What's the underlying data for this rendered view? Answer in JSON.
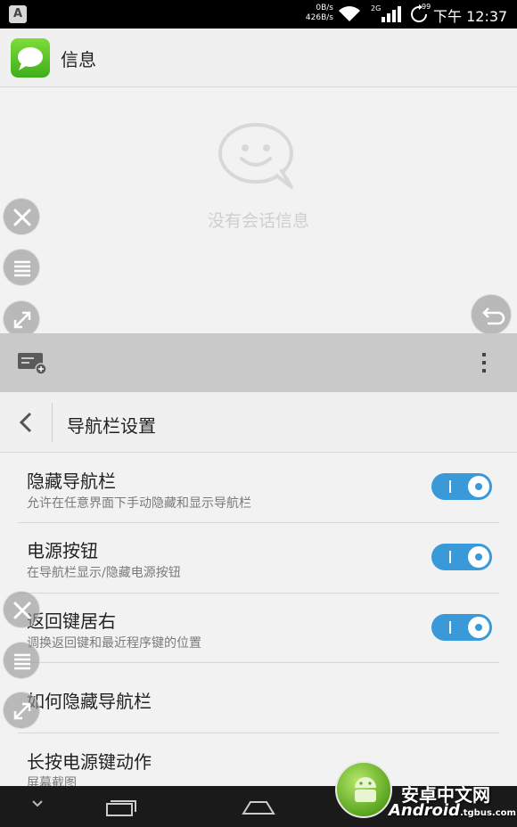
{
  "status_bar": {
    "badge": "A",
    "speed_up": "0B/s",
    "speed_down": "426B/s",
    "network": "2G",
    "sync_badge": "99",
    "time": "下午 12:37"
  },
  "app": {
    "title": "信息",
    "icon": "message-bubble-icon",
    "icon_color": "#5cc72a"
  },
  "messages": {
    "empty_text": "没有会话信息"
  },
  "floating_controls": [
    "close-icon",
    "menu-icon",
    "resize-icon"
  ],
  "back_float": "return-icon",
  "toolbar": {
    "compose_icon": "new-message-icon",
    "more_icon": "overflow-menu-icon"
  },
  "nav_settings": {
    "title": "导航栏设置",
    "items": [
      {
        "title": "隐藏导航栏",
        "subtitle": "允许在任意界面下手动隐藏和显示导航栏",
        "toggle": true
      },
      {
        "title": "电源按钮",
        "subtitle": "在导航栏显示/隐藏电源按钮",
        "toggle": true
      },
      {
        "title": "返回键居右",
        "subtitle": "调换返回键和最近程序键的位置",
        "toggle": true
      },
      {
        "title": "如何隐藏导航栏"
      },
      {
        "title": "长按电源键动作",
        "subtitle": "屏幕截图"
      }
    ]
  },
  "watermark": {
    "cn": "安卓中文网",
    "en": "Android",
    "domain": ".tgbus.com"
  },
  "colors": {
    "accent": "#3a9ad9",
    "toolbar": "#c9c9c9",
    "navbar": "#1a1a1a"
  }
}
